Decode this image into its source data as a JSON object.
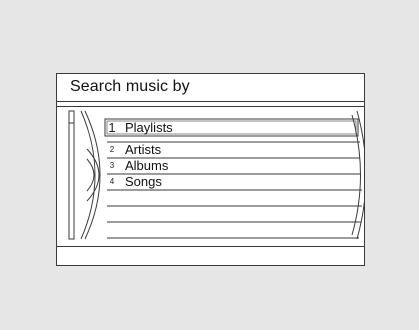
{
  "header": {
    "title": "Search music by"
  },
  "menu": {
    "items": [
      {
        "number": "1",
        "label": "Playlists",
        "selected": true
      },
      {
        "number": "2",
        "label": "Artists",
        "selected": false
      },
      {
        "number": "3",
        "label": "Albums",
        "selected": false
      },
      {
        "number": "4",
        "label": "Songs",
        "selected": false
      }
    ]
  },
  "colors": {
    "background": "#e6e6e6",
    "panel": "#ffffff",
    "line": "#3a3a3a"
  }
}
